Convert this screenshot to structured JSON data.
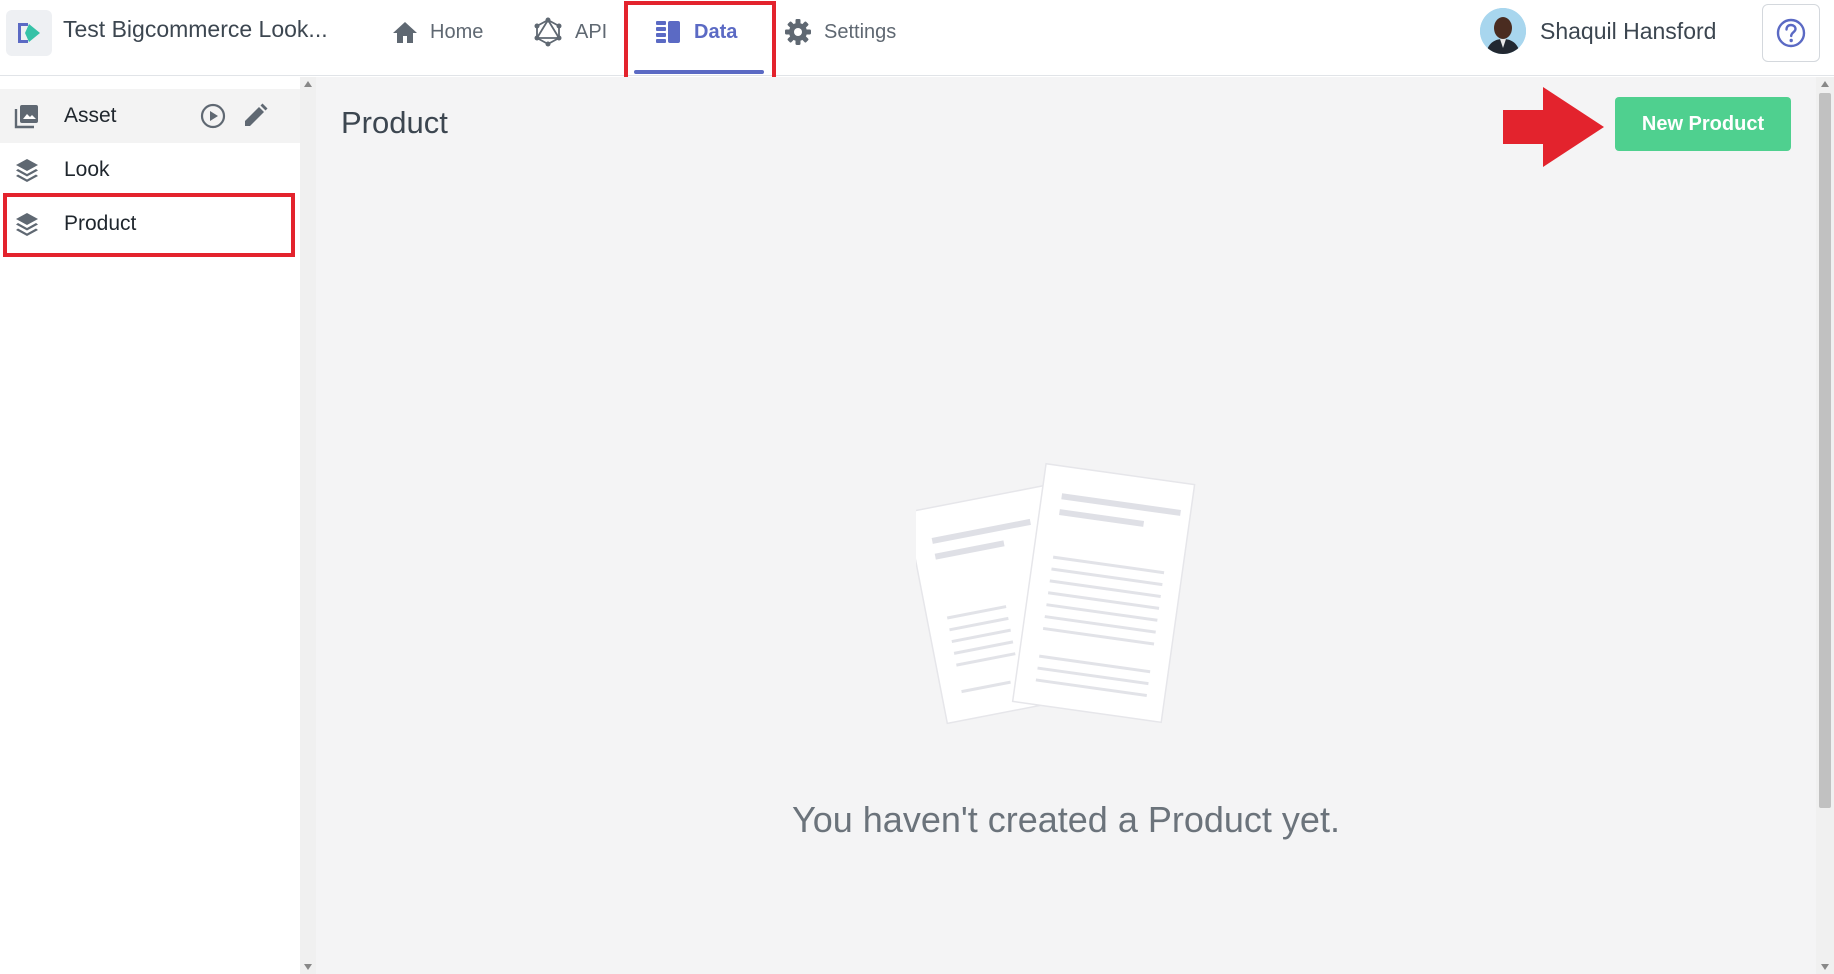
{
  "header": {
    "project_name": "Test Bigcommerce Look...",
    "nav": [
      {
        "label": "Home",
        "icon": "home-icon"
      },
      {
        "label": "API",
        "icon": "graphql-icon"
      },
      {
        "label": "Data",
        "icon": "data-icon",
        "active": true
      },
      {
        "label": "Settings",
        "icon": "gear-icon"
      }
    ],
    "user_name": "Shaquil Hansford",
    "help_icon": "help-icon"
  },
  "sidebar": {
    "items": [
      {
        "label": "Asset",
        "icon": "image-icon",
        "actions": [
          "play-circle-icon",
          "pencil-icon"
        ]
      },
      {
        "label": "Look",
        "icon": "layers-icon"
      },
      {
        "label": "Product",
        "icon": "layers-icon",
        "highlighted": true
      }
    ]
  },
  "main": {
    "title": "Product",
    "new_button_label": "New Product",
    "empty_message": "You haven't created a Product yet."
  },
  "colors": {
    "accent": "#5b6ac4",
    "primary_button": "#4fd08f",
    "annotation_red": "#e3232d",
    "main_bg": "#f4f4f5"
  }
}
